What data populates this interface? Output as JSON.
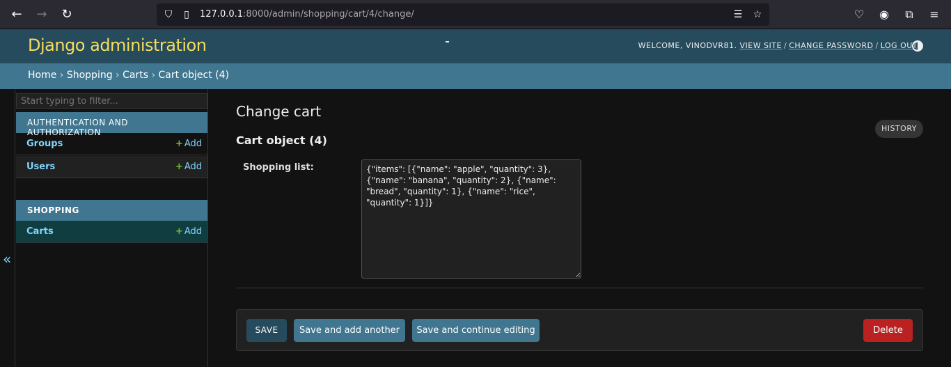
{
  "browser": {
    "url_host": "127.0.0.1",
    "url_rest": ":8000/admin/shopping/cart/4/change/"
  },
  "header": {
    "site_name": "Django administration",
    "welcome": "WELCOME, ",
    "username": "VINODVR81",
    "view_site": "VIEW SITE",
    "change_password": "CHANGE PASSWORD",
    "log_out": "LOG OUT"
  },
  "breadcrumbs": {
    "home": "Home",
    "shopping": "Shopping",
    "carts": "Carts",
    "current": "Cart object (4)"
  },
  "sidebar": {
    "filter_placeholder": "Start typing to filter...",
    "apps": [
      {
        "caption": "Authentication and Authorization",
        "models": [
          {
            "name": "Groups",
            "add": "Add"
          },
          {
            "name": "Users",
            "add": "Add"
          }
        ]
      },
      {
        "caption": "Shopping",
        "models": [
          {
            "name": "Carts",
            "add": "Add"
          }
        ]
      }
    ],
    "toggle": "«"
  },
  "content": {
    "title": "Change cart",
    "history": "HISTORY",
    "object_title": "Cart object (4)",
    "field_label": "Shopping list:",
    "field_value": "{\"items\": [{\"name\": \"apple\", \"quantity\": 3}, {\"name\": \"banana\", \"quantity\": 2}, {\"name\": \"bread\", \"quantity\": 1}, {\"name\": \"rice\", \"quantity\": 1}]}"
  },
  "buttons": {
    "save": "SAVE",
    "save_add": "Save and add another",
    "save_continue": "Save and continue editing",
    "delete": "Delete"
  }
}
